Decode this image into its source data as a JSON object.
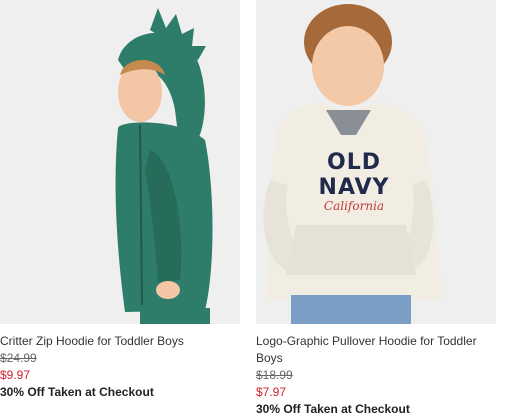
{
  "products": [
    {
      "name": "Critter Zip Hoodie for Toddler Boys",
      "original_price": "$24.99",
      "sale_price": "$9.97",
      "promo": "30% Off Taken at Checkout",
      "hoodie_color": "#2e7d6a"
    },
    {
      "name": "Logo-Graphic Pullover Hoodie for Toddler Boys",
      "original_price": "$18.99",
      "sale_price": "$7.97",
      "promo": "30% Off Taken at Checkout",
      "hoodie_color": "#f1ede3",
      "print_line1": "OLD NAVY",
      "print_line2": "California"
    }
  ],
  "colors": {
    "sale": "#d0202e",
    "text": "#333333"
  }
}
